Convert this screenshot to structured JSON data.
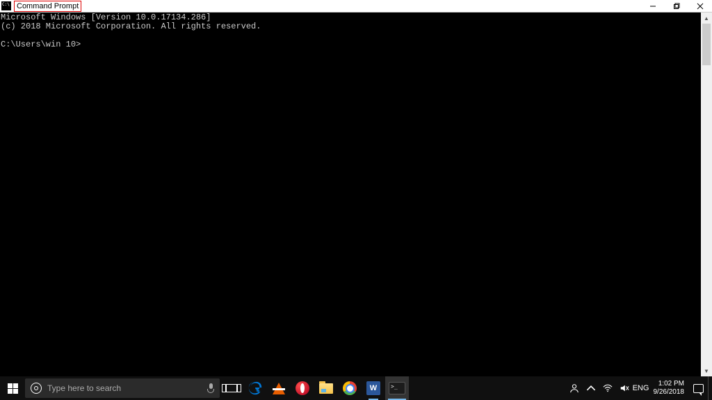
{
  "window": {
    "title": "Command Prompt"
  },
  "console": {
    "line1": "Microsoft Windows [Version 10.0.17134.286]",
    "line2": "(c) 2018 Microsoft Corporation. All rights reserved.",
    "prompt": "C:\\Users\\win 10>"
  },
  "taskbar": {
    "search_placeholder": "Type here to search",
    "word_initial": "W",
    "language": "ENG",
    "time": "1:02 PM",
    "date": "9/26/2018"
  }
}
